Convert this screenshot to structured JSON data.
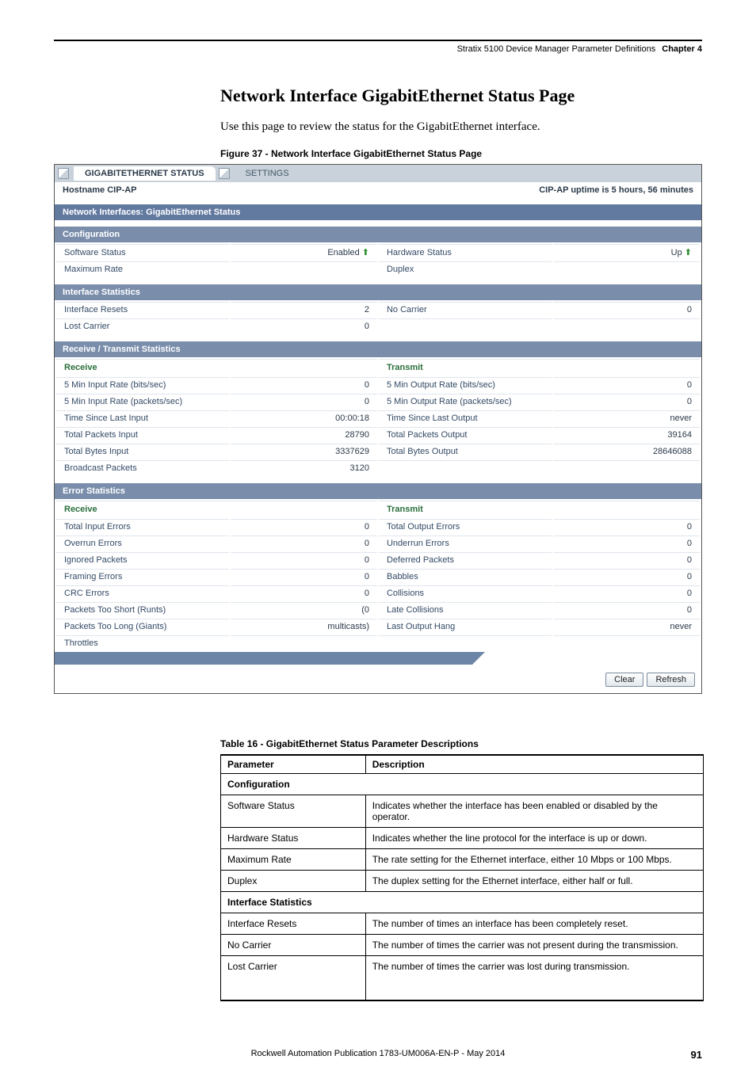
{
  "header": {
    "title": "Stratix 5100 Device Manager Parameter Definitions",
    "chapter": "Chapter 4"
  },
  "section": {
    "title": "Network Interface GigabitEthernet Status Page",
    "desc": "Use this page to review the status for the GigabitEthernet interface.",
    "figure_label": "Figure 37 - Network Interface GigabitEthernet Status Page"
  },
  "screenshot": {
    "tabs": {
      "active": "GIGABITETHERNET STATUS",
      "other": "SETTINGS"
    },
    "hostname_label": "Hostname CIP-AP",
    "uptime": "CIP-AP uptime is 5 hours, 56 minutes",
    "panel_title": "Network Interfaces: GigabitEthernet Status",
    "config_header": "Configuration",
    "config": {
      "software_status_label": "Software Status",
      "software_status_value": "Enabled",
      "hardware_status_label": "Hardware Status",
      "hardware_status_value": "Up",
      "max_rate_label": "Maximum Rate",
      "max_rate_value": "",
      "duplex_label": "Duplex",
      "duplex_value": ""
    },
    "ifstats_header": "Interface Statistics",
    "ifstats": {
      "resets_label": "Interface Resets",
      "resets_value": "2",
      "nocarrier_label": "No Carrier",
      "nocarrier_value": "0",
      "lostcarrier_label": "Lost Carrier",
      "lostcarrier_value": "0"
    },
    "rt_header": "Receive / Transmit Statistics",
    "rt": {
      "receive_head": "Receive",
      "transmit_head": "Transmit",
      "rows": {
        "r1l": "5 Min Input Rate (bits/sec)",
        "r1lv": "0",
        "r1r": "5 Min Output Rate (bits/sec)",
        "r1rv": "0",
        "r2l": "5 Min Input Rate (packets/sec)",
        "r2lv": "0",
        "r2r": "5 Min Output Rate (packets/sec)",
        "r2rv": "0",
        "r3l": "Time Since Last Input",
        "r3lv": "00:00:18",
        "r3r": "Time Since Last Output",
        "r3rv": "never",
        "r4l": "Total Packets Input",
        "r4lv": "28790",
        "r4r": "Total Packets Output",
        "r4rv": "39164",
        "r5l": "Total Bytes Input",
        "r5lv": "3337629",
        "r5r": "Total Bytes Output",
        "r5rv": "28646088",
        "r6l": "Broadcast Packets",
        "r6lv": "3120"
      }
    },
    "err_header": "Error Statistics",
    "err": {
      "receive_head": "Receive",
      "transmit_head": "Transmit",
      "rows": {
        "e1l": "Total Input Errors",
        "e1lv": "0",
        "e1r": "Total Output Errors",
        "e1rv": "0",
        "e2l": "Overrun Errors",
        "e2lv": "0",
        "e2r": "Underrun Errors",
        "e2rv": "0",
        "e3l": "Ignored Packets",
        "e3lv": "0",
        "e3r": "Deferred Packets",
        "e3rv": "0",
        "e4l": "Framing Errors",
        "e4lv": "0",
        "e4r": "Babbles",
        "e4rv": "0",
        "e5l": "CRC Errors",
        "e5lv": "0",
        "e5r": "Collisions",
        "e5rv": "0",
        "e6l": "Packets Too Short (Runts)",
        "e6lv": "(0",
        "e6r": "Late Collisions",
        "e6rv": "0",
        "e7l": "Packets Too Long (Giants)",
        "e7lv": "multicasts)",
        "e7r": "Last Output Hang",
        "e7rv": "never",
        "e8l": "Throttles",
        "e8lv": ""
      }
    },
    "buttons": {
      "clear": "Clear",
      "refresh": "Refresh"
    }
  },
  "table": {
    "label": "Table 16 - GigabitEthernet Status Parameter Descriptions",
    "head_param": "Parameter",
    "head_desc": "Description",
    "group1": "Configuration",
    "r1p": "Software Status",
    "r1d": "Indicates whether the interface has been enabled or disabled by the operator.",
    "r2p": "Hardware Status",
    "r2d": "Indicates whether the line protocol for the interface is up or down.",
    "r3p": "Maximum Rate",
    "r3d": "The rate setting for the Ethernet interface, either 10 Mbps or 100 Mbps.",
    "r4p": "Duplex",
    "r4d": "The duplex setting for the Ethernet interface, either half or full.",
    "group2": "Interface Statistics",
    "r5p": "Interface Resets",
    "r5d": "The number of times an interface has been completely reset.",
    "r6p": "No Carrier",
    "r6d": "The number of times the carrier was not present during the transmission.",
    "r7p": "Lost Carrier",
    "r7d": "The number of times the carrier was lost during transmission."
  },
  "footer": {
    "pub": "Rockwell Automation Publication 1783-UM006A-EN-P - May 2014",
    "pageno": "91"
  }
}
